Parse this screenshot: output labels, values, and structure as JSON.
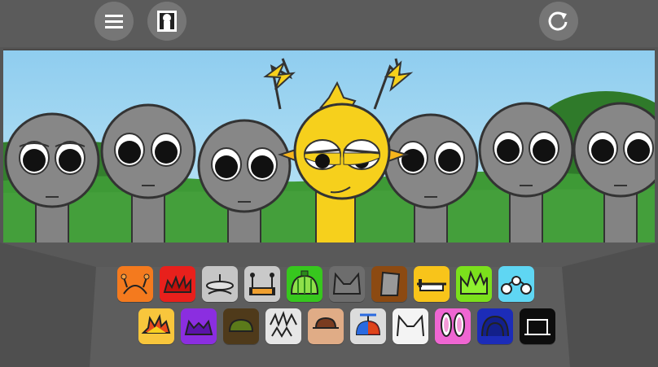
{
  "toolbar": {
    "menu_icon": "hamburger-menu-icon",
    "gallery_icon": "portrait-icon",
    "reset_icon": "reload-icon"
  },
  "colors": {
    "sky": "#9fd3ee",
    "grass": "#3f9b3a",
    "singer_grey": "#808080",
    "lead_yellow": "#f6d01c",
    "ui_dark": "#595959"
  },
  "stage": {
    "characters": [
      {
        "name": "grey-singer-1",
        "state": "idle"
      },
      {
        "name": "grey-singer-2",
        "state": "idle"
      },
      {
        "name": "grey-singer-3",
        "state": "idle"
      },
      {
        "name": "yellow-singer",
        "state": "active"
      },
      {
        "name": "grey-singer-4",
        "state": "idle"
      },
      {
        "name": "grey-singer-5",
        "state": "idle"
      },
      {
        "name": "grey-singer-6",
        "state": "idle"
      }
    ]
  },
  "palette": {
    "row1": [
      {
        "icon": "orange-antenna-headband-icon",
        "color": "#f47a1e"
      },
      {
        "icon": "red-spiky-hair-icon",
        "color": "#e8201c"
      },
      {
        "icon": "grey-halo-disc-icon",
        "color": "#c6c6c6"
      },
      {
        "icon": "silver-antenna-headset-icon",
        "color": "#c9c9c9"
      },
      {
        "icon": "green-melon-cap-icon",
        "color": "#37c71e"
      },
      {
        "icon": "grey-cat-ears-icon",
        "color": "#6d6d6d"
      },
      {
        "icon": "brown-hat-icon",
        "color": "#8c4a12"
      },
      {
        "icon": "yellow-helmet-visor-icon",
        "color": "#f8c41a"
      },
      {
        "icon": "lime-spiky-hair-icon",
        "color": "#7be01c"
      },
      {
        "icon": "cyan-headphones-icon",
        "color": "#5fd6f3"
      }
    ],
    "row2": [
      {
        "icon": "yellow-crown-spikes-icon",
        "color": "#f8c63c"
      },
      {
        "icon": "purple-horned-hair-icon",
        "color": "#8b2ee0"
      },
      {
        "icon": "dark-olive-cap-icon",
        "color": "#4f3a1a"
      },
      {
        "icon": "white-scribble-hair-icon",
        "color": "#e6e6e6"
      },
      {
        "icon": "tan-cap-icon",
        "color": "#e0ac86"
      },
      {
        "icon": "propeller-beanie-icon",
        "color": "#dcdcdc"
      },
      {
        "icon": "white-cat-ears-icon",
        "color": "#f4f4f4"
      },
      {
        "icon": "pink-bunny-ears-icon",
        "color": "#ef66d2"
      },
      {
        "icon": "navy-hood-icon",
        "color": "#1c2cb8"
      },
      {
        "icon": "black-frame-icon",
        "color": "#0d0d0d"
      }
    ]
  }
}
